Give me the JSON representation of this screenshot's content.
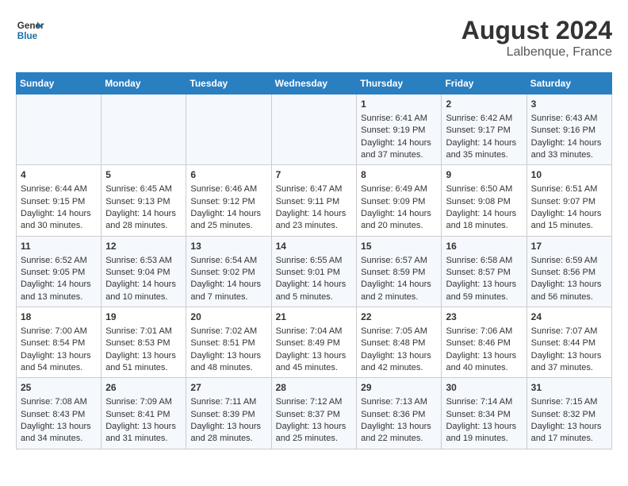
{
  "header": {
    "logo_line1": "General",
    "logo_line2": "Blue",
    "month_year": "August 2024",
    "location": "Lalbenque, France"
  },
  "days_of_week": [
    "Sunday",
    "Monday",
    "Tuesday",
    "Wednesday",
    "Thursday",
    "Friday",
    "Saturday"
  ],
  "weeks": [
    [
      {
        "day": "",
        "content": ""
      },
      {
        "day": "",
        "content": ""
      },
      {
        "day": "",
        "content": ""
      },
      {
        "day": "",
        "content": ""
      },
      {
        "day": "1",
        "content": "Sunrise: 6:41 AM\nSunset: 9:19 PM\nDaylight: 14 hours\nand 37 minutes."
      },
      {
        "day": "2",
        "content": "Sunrise: 6:42 AM\nSunset: 9:17 PM\nDaylight: 14 hours\nand 35 minutes."
      },
      {
        "day": "3",
        "content": "Sunrise: 6:43 AM\nSunset: 9:16 PM\nDaylight: 14 hours\nand 33 minutes."
      }
    ],
    [
      {
        "day": "4",
        "content": "Sunrise: 6:44 AM\nSunset: 9:15 PM\nDaylight: 14 hours\nand 30 minutes."
      },
      {
        "day": "5",
        "content": "Sunrise: 6:45 AM\nSunset: 9:13 PM\nDaylight: 14 hours\nand 28 minutes."
      },
      {
        "day": "6",
        "content": "Sunrise: 6:46 AM\nSunset: 9:12 PM\nDaylight: 14 hours\nand 25 minutes."
      },
      {
        "day": "7",
        "content": "Sunrise: 6:47 AM\nSunset: 9:11 PM\nDaylight: 14 hours\nand 23 minutes."
      },
      {
        "day": "8",
        "content": "Sunrise: 6:49 AM\nSunset: 9:09 PM\nDaylight: 14 hours\nand 20 minutes."
      },
      {
        "day": "9",
        "content": "Sunrise: 6:50 AM\nSunset: 9:08 PM\nDaylight: 14 hours\nand 18 minutes."
      },
      {
        "day": "10",
        "content": "Sunrise: 6:51 AM\nSunset: 9:07 PM\nDaylight: 14 hours\nand 15 minutes."
      }
    ],
    [
      {
        "day": "11",
        "content": "Sunrise: 6:52 AM\nSunset: 9:05 PM\nDaylight: 14 hours\nand 13 minutes."
      },
      {
        "day": "12",
        "content": "Sunrise: 6:53 AM\nSunset: 9:04 PM\nDaylight: 14 hours\nand 10 minutes."
      },
      {
        "day": "13",
        "content": "Sunrise: 6:54 AM\nSunset: 9:02 PM\nDaylight: 14 hours\nand 7 minutes."
      },
      {
        "day": "14",
        "content": "Sunrise: 6:55 AM\nSunset: 9:01 PM\nDaylight: 14 hours\nand 5 minutes."
      },
      {
        "day": "15",
        "content": "Sunrise: 6:57 AM\nSunset: 8:59 PM\nDaylight: 14 hours\nand 2 minutes."
      },
      {
        "day": "16",
        "content": "Sunrise: 6:58 AM\nSunset: 8:57 PM\nDaylight: 13 hours\nand 59 minutes."
      },
      {
        "day": "17",
        "content": "Sunrise: 6:59 AM\nSunset: 8:56 PM\nDaylight: 13 hours\nand 56 minutes."
      }
    ],
    [
      {
        "day": "18",
        "content": "Sunrise: 7:00 AM\nSunset: 8:54 PM\nDaylight: 13 hours\nand 54 minutes."
      },
      {
        "day": "19",
        "content": "Sunrise: 7:01 AM\nSunset: 8:53 PM\nDaylight: 13 hours\nand 51 minutes."
      },
      {
        "day": "20",
        "content": "Sunrise: 7:02 AM\nSunset: 8:51 PM\nDaylight: 13 hours\nand 48 minutes."
      },
      {
        "day": "21",
        "content": "Sunrise: 7:04 AM\nSunset: 8:49 PM\nDaylight: 13 hours\nand 45 minutes."
      },
      {
        "day": "22",
        "content": "Sunrise: 7:05 AM\nSunset: 8:48 PM\nDaylight: 13 hours\nand 42 minutes."
      },
      {
        "day": "23",
        "content": "Sunrise: 7:06 AM\nSunset: 8:46 PM\nDaylight: 13 hours\nand 40 minutes."
      },
      {
        "day": "24",
        "content": "Sunrise: 7:07 AM\nSunset: 8:44 PM\nDaylight: 13 hours\nand 37 minutes."
      }
    ],
    [
      {
        "day": "25",
        "content": "Sunrise: 7:08 AM\nSunset: 8:43 PM\nDaylight: 13 hours\nand 34 minutes."
      },
      {
        "day": "26",
        "content": "Sunrise: 7:09 AM\nSunset: 8:41 PM\nDaylight: 13 hours\nand 31 minutes."
      },
      {
        "day": "27",
        "content": "Sunrise: 7:11 AM\nSunset: 8:39 PM\nDaylight: 13 hours\nand 28 minutes."
      },
      {
        "day": "28",
        "content": "Sunrise: 7:12 AM\nSunset: 8:37 PM\nDaylight: 13 hours\nand 25 minutes."
      },
      {
        "day": "29",
        "content": "Sunrise: 7:13 AM\nSunset: 8:36 PM\nDaylight: 13 hours\nand 22 minutes."
      },
      {
        "day": "30",
        "content": "Sunrise: 7:14 AM\nSunset: 8:34 PM\nDaylight: 13 hours\nand 19 minutes."
      },
      {
        "day": "31",
        "content": "Sunrise: 7:15 AM\nSunset: 8:32 PM\nDaylight: 13 hours\nand 17 minutes."
      }
    ]
  ]
}
